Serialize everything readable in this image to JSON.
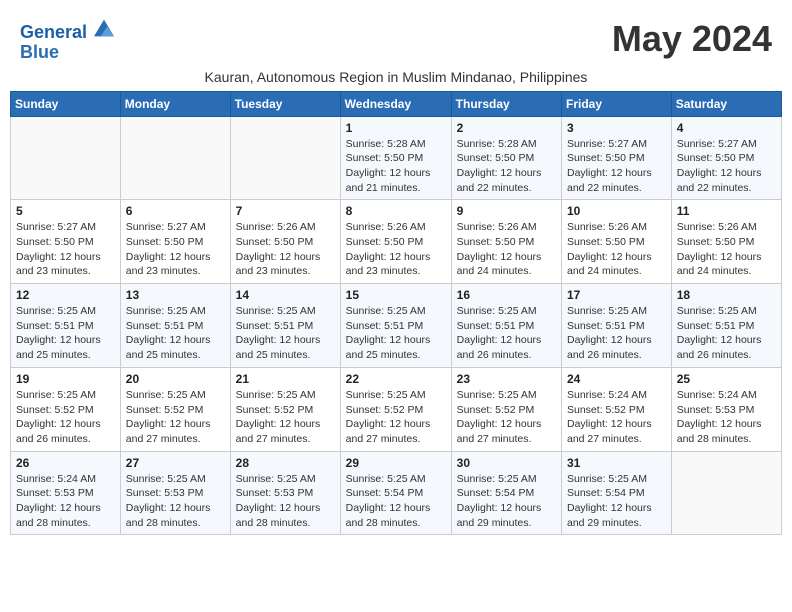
{
  "header": {
    "logo_line1": "General",
    "logo_line2": "Blue",
    "month_year": "May 2024",
    "subtitle": "Kauran, Autonomous Region in Muslim Mindanao, Philippines"
  },
  "days_of_week": [
    "Sunday",
    "Monday",
    "Tuesday",
    "Wednesday",
    "Thursday",
    "Friday",
    "Saturday"
  ],
  "weeks": [
    [
      {
        "day": "",
        "info": ""
      },
      {
        "day": "",
        "info": ""
      },
      {
        "day": "",
        "info": ""
      },
      {
        "day": "1",
        "info": "Sunrise: 5:28 AM\nSunset: 5:50 PM\nDaylight: 12 hours\nand 21 minutes."
      },
      {
        "day": "2",
        "info": "Sunrise: 5:28 AM\nSunset: 5:50 PM\nDaylight: 12 hours\nand 22 minutes."
      },
      {
        "day": "3",
        "info": "Sunrise: 5:27 AM\nSunset: 5:50 PM\nDaylight: 12 hours\nand 22 minutes."
      },
      {
        "day": "4",
        "info": "Sunrise: 5:27 AM\nSunset: 5:50 PM\nDaylight: 12 hours\nand 22 minutes."
      }
    ],
    [
      {
        "day": "5",
        "info": "Sunrise: 5:27 AM\nSunset: 5:50 PM\nDaylight: 12 hours\nand 23 minutes."
      },
      {
        "day": "6",
        "info": "Sunrise: 5:27 AM\nSunset: 5:50 PM\nDaylight: 12 hours\nand 23 minutes."
      },
      {
        "day": "7",
        "info": "Sunrise: 5:26 AM\nSunset: 5:50 PM\nDaylight: 12 hours\nand 23 minutes."
      },
      {
        "day": "8",
        "info": "Sunrise: 5:26 AM\nSunset: 5:50 PM\nDaylight: 12 hours\nand 23 minutes."
      },
      {
        "day": "9",
        "info": "Sunrise: 5:26 AM\nSunset: 5:50 PM\nDaylight: 12 hours\nand 24 minutes."
      },
      {
        "day": "10",
        "info": "Sunrise: 5:26 AM\nSunset: 5:50 PM\nDaylight: 12 hours\nand 24 minutes."
      },
      {
        "day": "11",
        "info": "Sunrise: 5:26 AM\nSunset: 5:50 PM\nDaylight: 12 hours\nand 24 minutes."
      }
    ],
    [
      {
        "day": "12",
        "info": "Sunrise: 5:25 AM\nSunset: 5:51 PM\nDaylight: 12 hours\nand 25 minutes."
      },
      {
        "day": "13",
        "info": "Sunrise: 5:25 AM\nSunset: 5:51 PM\nDaylight: 12 hours\nand 25 minutes."
      },
      {
        "day": "14",
        "info": "Sunrise: 5:25 AM\nSunset: 5:51 PM\nDaylight: 12 hours\nand 25 minutes."
      },
      {
        "day": "15",
        "info": "Sunrise: 5:25 AM\nSunset: 5:51 PM\nDaylight: 12 hours\nand 25 minutes."
      },
      {
        "day": "16",
        "info": "Sunrise: 5:25 AM\nSunset: 5:51 PM\nDaylight: 12 hours\nand 26 minutes."
      },
      {
        "day": "17",
        "info": "Sunrise: 5:25 AM\nSunset: 5:51 PM\nDaylight: 12 hours\nand 26 minutes."
      },
      {
        "day": "18",
        "info": "Sunrise: 5:25 AM\nSunset: 5:51 PM\nDaylight: 12 hours\nand 26 minutes."
      }
    ],
    [
      {
        "day": "19",
        "info": "Sunrise: 5:25 AM\nSunset: 5:52 PM\nDaylight: 12 hours\nand 26 minutes."
      },
      {
        "day": "20",
        "info": "Sunrise: 5:25 AM\nSunset: 5:52 PM\nDaylight: 12 hours\nand 27 minutes."
      },
      {
        "day": "21",
        "info": "Sunrise: 5:25 AM\nSunset: 5:52 PM\nDaylight: 12 hours\nand 27 minutes."
      },
      {
        "day": "22",
        "info": "Sunrise: 5:25 AM\nSunset: 5:52 PM\nDaylight: 12 hours\nand 27 minutes."
      },
      {
        "day": "23",
        "info": "Sunrise: 5:25 AM\nSunset: 5:52 PM\nDaylight: 12 hours\nand 27 minutes."
      },
      {
        "day": "24",
        "info": "Sunrise: 5:24 AM\nSunset: 5:52 PM\nDaylight: 12 hours\nand 27 minutes."
      },
      {
        "day": "25",
        "info": "Sunrise: 5:24 AM\nSunset: 5:53 PM\nDaylight: 12 hours\nand 28 minutes."
      }
    ],
    [
      {
        "day": "26",
        "info": "Sunrise: 5:24 AM\nSunset: 5:53 PM\nDaylight: 12 hours\nand 28 minutes."
      },
      {
        "day": "27",
        "info": "Sunrise: 5:25 AM\nSunset: 5:53 PM\nDaylight: 12 hours\nand 28 minutes."
      },
      {
        "day": "28",
        "info": "Sunrise: 5:25 AM\nSunset: 5:53 PM\nDaylight: 12 hours\nand 28 minutes."
      },
      {
        "day": "29",
        "info": "Sunrise: 5:25 AM\nSunset: 5:54 PM\nDaylight: 12 hours\nand 28 minutes."
      },
      {
        "day": "30",
        "info": "Sunrise: 5:25 AM\nSunset: 5:54 PM\nDaylight: 12 hours\nand 29 minutes."
      },
      {
        "day": "31",
        "info": "Sunrise: 5:25 AM\nSunset: 5:54 PM\nDaylight: 12 hours\nand 29 minutes."
      },
      {
        "day": "",
        "info": ""
      }
    ]
  ]
}
